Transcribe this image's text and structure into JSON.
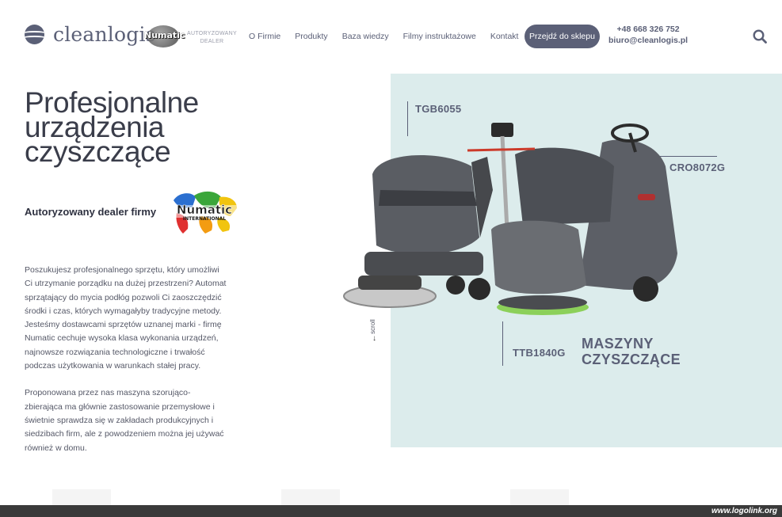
{
  "header": {
    "logo_text": "cleanlogis",
    "badge_word": "Numatic",
    "dealer_tag_line1": "AUTORYZOWANY",
    "dealer_tag_line2": "DEALER",
    "nav": [
      "O Firmie",
      "Produkty",
      "Baza wiedzy",
      "Filmy instruktażowe",
      "Kontakt"
    ],
    "shop_button": "Przejdź do sklepu",
    "phone": "+48 668 326 752",
    "email": "biuro@cleanlogis.pl"
  },
  "hero": {
    "title_lines": [
      "Profesjonalne",
      "urządzenia",
      "czyszczące"
    ],
    "dealer_line": "Autoryzowany dealer firmy",
    "numatic_logo_word": "Numatic",
    "numatic_logo_sub": "INTERNATIONAL",
    "paragraph1": "Poszukujesz profesjonalnego sprzętu, który umożliwi Ci utrzymanie porządku na dużej przestrzeni? Automat sprzątający do mycia podłóg pozwoli Ci zaoszczędzić środki i czas, których wymagałyby tradycyjne metody. Jesteśmy dostawcami sprzętów uznanej marki - firmę Numatic cechuje wysoka klasa wykonania urządzeń, najnowsze rozwiązania technologiczne i trwałość podczas użytkowania w warunkach stałej pracy.",
    "paragraph2": "Proponowana przez nas maszyna szorująco-zbierająca ma głównie zastosowanie przemysłowe i świetnie sprawdza się w zakładach produkcyjnych i siedzibach firm, ale z powodzeniem można jej używać również w domu."
  },
  "panel": {
    "models": [
      "TGB6055",
      "CRO8072G",
      "TTB1840G"
    ],
    "machines_title_line1": "MASZYNY",
    "machines_title_line2": "CZYSZCZĄCE",
    "scroll_label": "scroll",
    "scroll_arrow": "↓",
    "background_color": "#dcecec",
    "accent_color": "#5b6077"
  },
  "footer": {
    "watermark": "www.logolink.org"
  }
}
